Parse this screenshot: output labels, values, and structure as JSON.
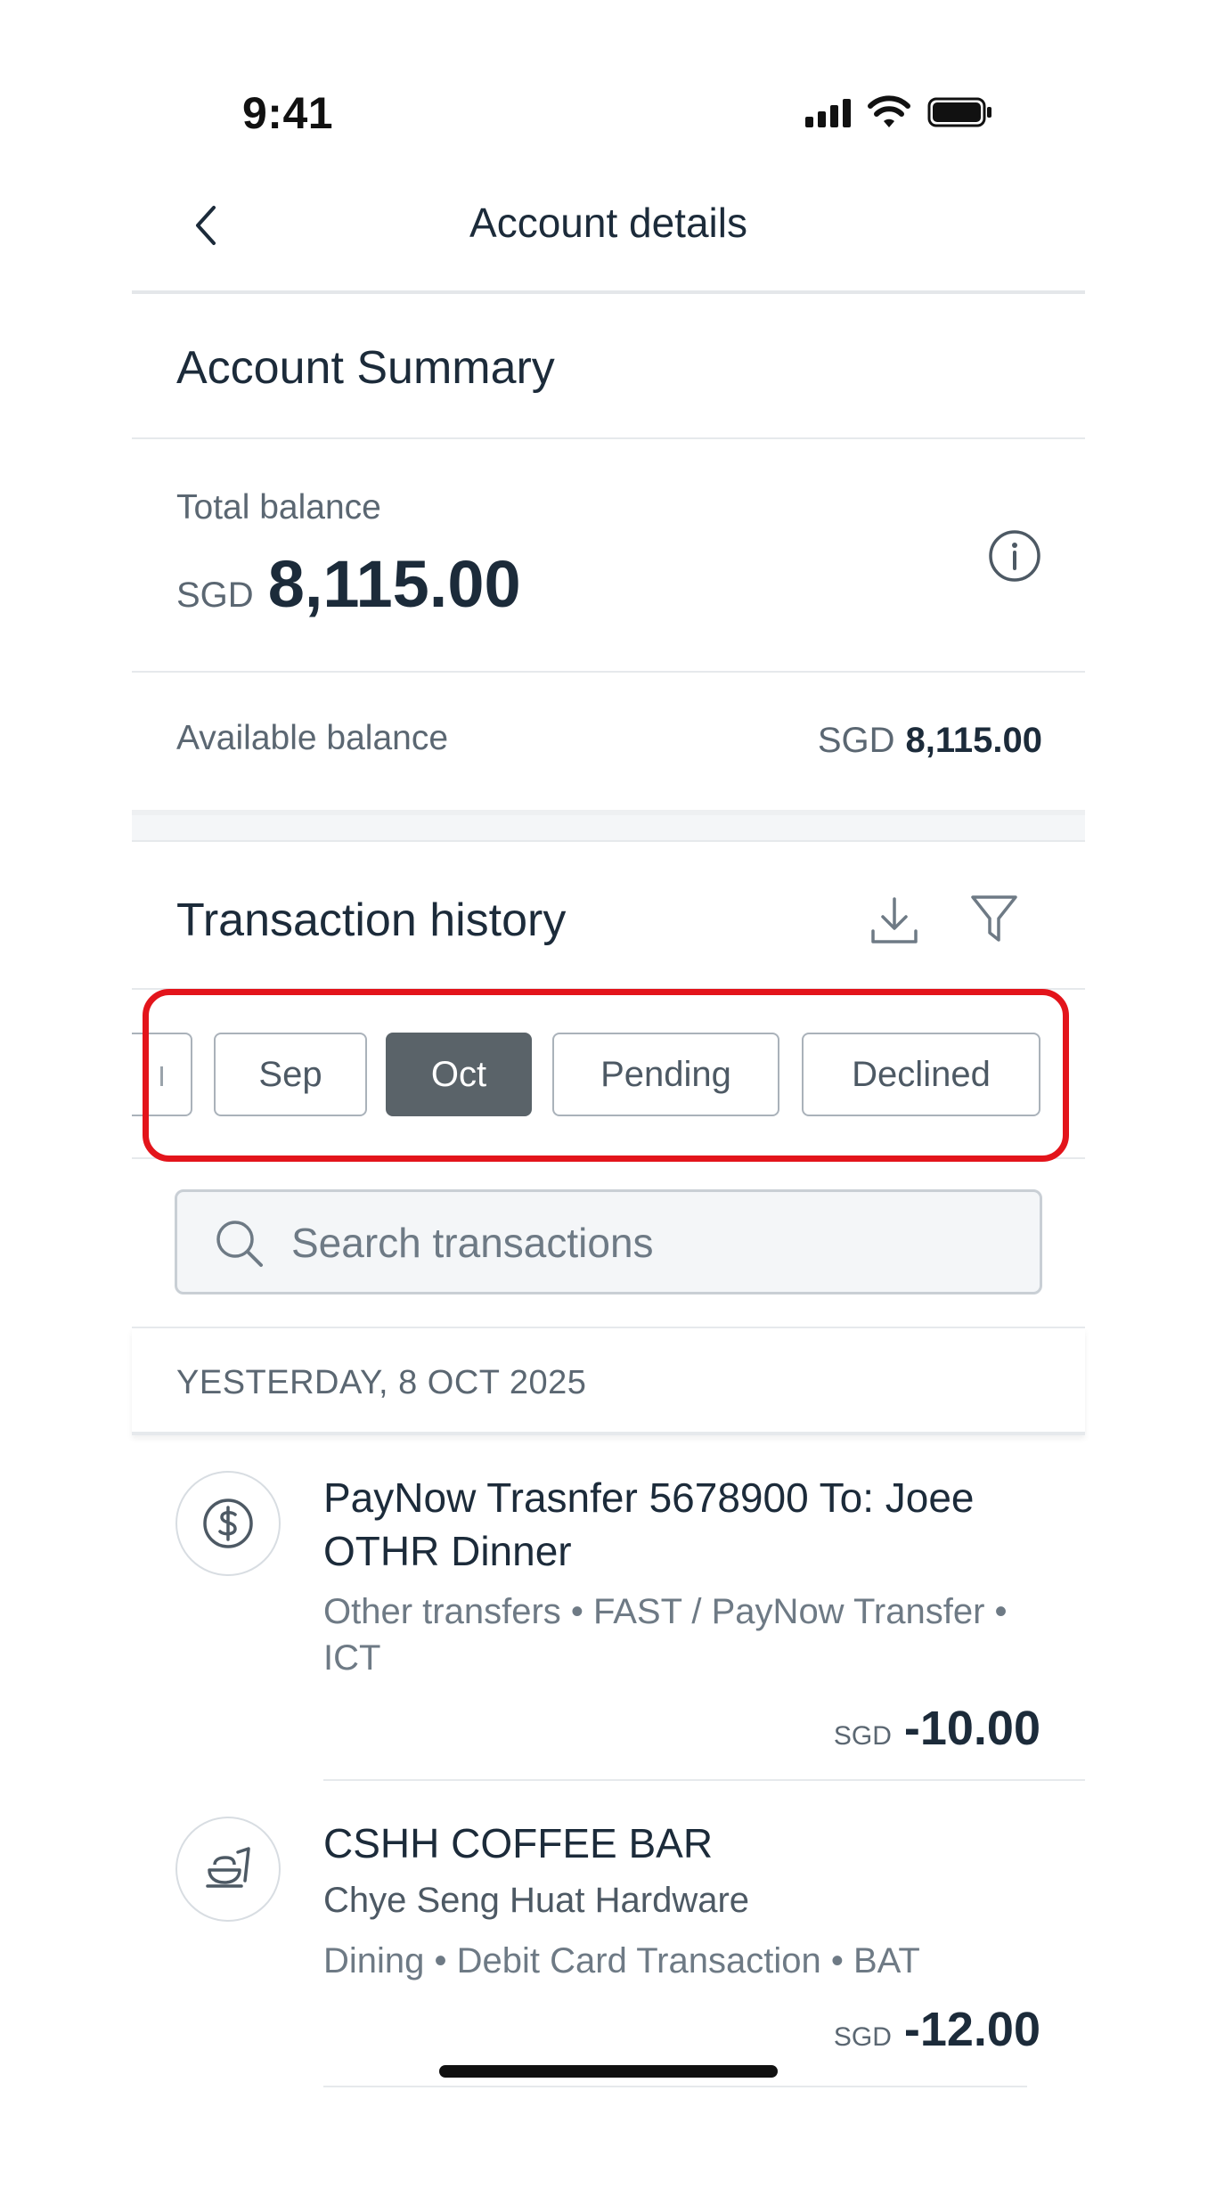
{
  "status_bar": {
    "time": "9:41"
  },
  "nav": {
    "title": "Account details",
    "back_icon": "chevron-left-icon"
  },
  "summary": {
    "heading": "Account Summary",
    "total_label": "Total balance",
    "total_currency": "SGD",
    "total_amount": "8,115.00",
    "available_label": "Available balance",
    "available_currency": "SGD",
    "available_amount": "8,115.00"
  },
  "history": {
    "title": "Transaction history",
    "chips": [
      {
        "label": "Sep",
        "selected": false
      },
      {
        "label": "Oct",
        "selected": true
      },
      {
        "label": "Pending",
        "selected": false
      },
      {
        "label": "Declined",
        "selected": false
      }
    ],
    "search_placeholder": "Search transactions",
    "date_header": "YESTERDAY, 8 OCT 2025",
    "transactions": [
      {
        "title": "PayNow Trasnfer 5678900 To: Joee OTHR Dinner",
        "subtitle": "Other transfers • FAST / PayNow Transfer • ICT",
        "currency": "SGD",
        "amount": "-10.00",
        "icon": "dollar-circle-icon"
      },
      {
        "title": "CSHH COFFEE BAR",
        "merchant": "Chye Seng Huat Hardware",
        "subtitle": "Dining • Debit Card Transaction • BAT",
        "currency": "SGD",
        "amount": "-12.00",
        "icon": "dining-icon"
      }
    ]
  },
  "colors": {
    "highlight": "#e3141b",
    "chip_selected": "#5a6369",
    "text_primary": "#1c2b3a"
  }
}
